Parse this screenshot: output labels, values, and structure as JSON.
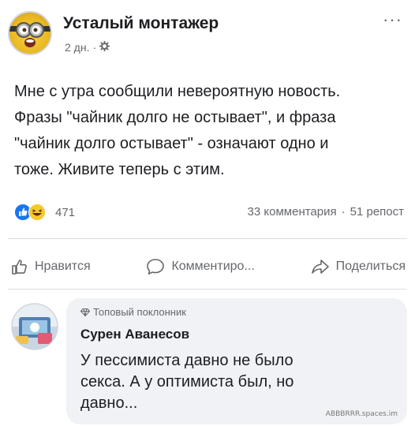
{
  "post": {
    "author": "Усталый монтажер",
    "time": "2 дн.",
    "separator": "·",
    "audience_icon": "gear-icon",
    "more_icon": "more-options-icon",
    "more_label": "···",
    "text_lines": [
      "Мне с утра сообщили невероятную новость.",
      "Фразы \"чайник долго не остывает\", и фраза",
      "\"чайник долго остывает\" - означают одно и",
      "тоже. Живите теперь с этим."
    ],
    "reactions": {
      "icons": [
        "like-reaction-icon",
        "haha-reaction-icon"
      ],
      "count": "471"
    },
    "comments_count": "33 комментария",
    "stats_separator": "·",
    "shares_count": "51 репост"
  },
  "actions": {
    "like": "Нравится",
    "comment": "Комментиро...",
    "share": "Поделиться"
  },
  "comment": {
    "badge_icon": "diamond-icon",
    "badge": "Топовый поклонник",
    "author": "Сурен Аванесов",
    "text_lines": [
      "У пессимиста давно не было",
      "секса. А у оптимиста был, но",
      "давно..."
    ],
    "watermark": "ABBBRRR.spaces.im"
  },
  "colors": {
    "text": "#1c1e21",
    "secondary": "#65676b",
    "bubble": "#f0f2f5",
    "like_blue": "#1877f2",
    "haha_yellow": "#f7c928"
  }
}
